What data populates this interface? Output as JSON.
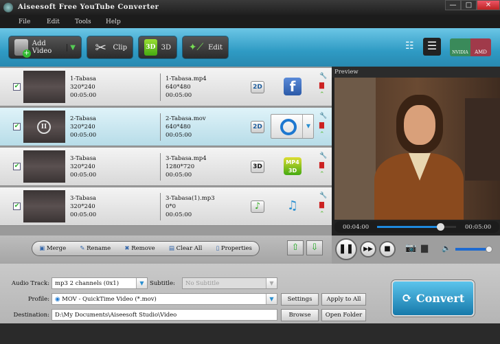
{
  "window": {
    "title": "Aiseesoft Free YouTube Converter",
    "minimize": "—",
    "maximize": "□",
    "close": "✕"
  },
  "menu": [
    "File",
    "Edit",
    "Tools",
    "Help"
  ],
  "toolbar": {
    "add_video": "Add Video",
    "clip": "Clip",
    "threed": "3D",
    "edit": "Edit",
    "nvidia": "NVIDIA",
    "amd": "AMD"
  },
  "files": [
    {
      "name": "1-Tabasa",
      "res": "320*240",
      "dur": "00:05:00",
      "out_name": "1-Tabasa.mp4",
      "out_res": "640*480",
      "out_dur": "00:05:00",
      "mode": "2D",
      "format_icon": "facebook-icon",
      "checked": true
    },
    {
      "name": "2-Tabasa",
      "res": "320*240",
      "dur": "00:05:00",
      "out_name": "2-Tabasa.mov",
      "out_res": "640*480",
      "out_dur": "00:05:00",
      "mode": "2D",
      "format_icon": "quicktime-icon",
      "checked": true
    },
    {
      "name": "3-Tabasa",
      "res": "320*240",
      "dur": "00:05:00",
      "out_name": "3-Tabasa.mp4",
      "out_res": "1280*720",
      "out_dur": "00:05:00",
      "mode": "3D",
      "format_icon": "mp4-3d-icon",
      "checked": true
    },
    {
      "name": "3-Tabasa",
      "res": "320*240",
      "dur": "00:05:00",
      "out_name": "3-Tabasa(1).mp3",
      "out_res": "0*0",
      "out_dur": "00:05:00",
      "mode": "♪",
      "format_icon": "mp3-icon",
      "checked": true
    }
  ],
  "preview": {
    "label": "Preview",
    "current": "00:04:00",
    "total": "00:05:00",
    "progress": 0.8,
    "volume": 0.95
  },
  "actions": {
    "merge": "Merge",
    "rename": "Rename",
    "remove": "Remove",
    "clear_all": "Clear All",
    "properties": "Properties"
  },
  "settings": {
    "audio_label": "Audio Track:",
    "audio_value": "mp3 2 channels (0x1)",
    "subtitle_label": "Subtitle:",
    "subtitle_value": "No Subtitle",
    "profile_label": "Profile:",
    "profile_value": "MOV - QuickTime Video (*.mov)",
    "dest_label": "Destination:",
    "dest_value": "D:\\My Documents\\Aiseesoft Studio\\Video",
    "settings_btn": "Settings",
    "apply_all": "Apply to All",
    "browse": "Browse",
    "open_folder": "Open Folder",
    "convert": "Convert"
  }
}
